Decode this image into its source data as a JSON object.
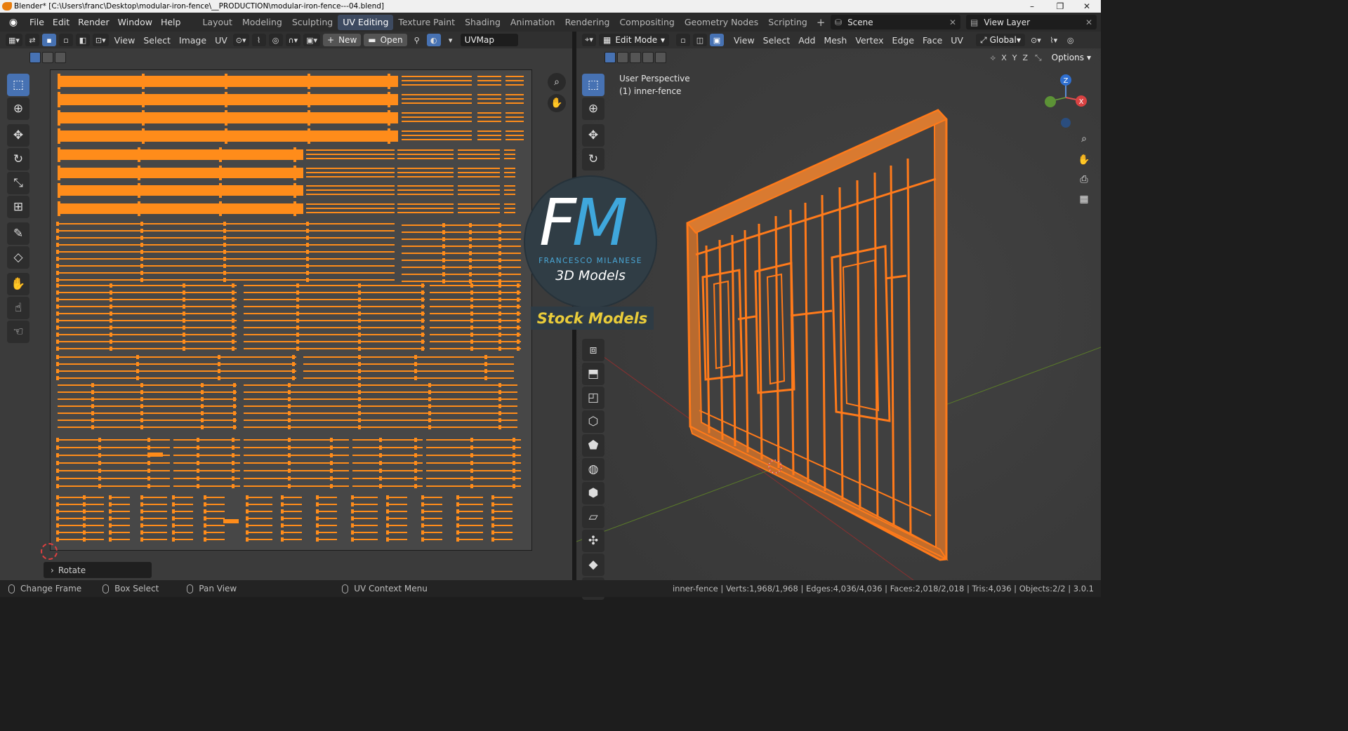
{
  "window": {
    "title": "Blender* [C:\\Users\\franc\\Desktop\\modular-iron-fence\\__PRODUCTION\\modular-iron-fence---04.blend]",
    "controls": {
      "minimize": "–",
      "maximize": "❐",
      "close": "✕"
    }
  },
  "topbar": {
    "menus": [
      "File",
      "Edit",
      "Render",
      "Window",
      "Help"
    ],
    "workspaces": [
      "Layout",
      "Modeling",
      "Sculpting",
      "UV Editing",
      "Texture Paint",
      "Shading",
      "Animation",
      "Rendering",
      "Compositing",
      "Geometry Nodes",
      "Scripting"
    ],
    "active_workspace": "UV Editing",
    "add_tab": "+",
    "scene": "Scene",
    "view_layer": "View Layer"
  },
  "uv_editor": {
    "menus": [
      "View",
      "Select",
      "Image",
      "UV"
    ],
    "new_label": "New",
    "open_label": "Open",
    "uvmap": "UVMap",
    "last_operator": "Rotate"
  },
  "viewport": {
    "mode": "Edit Mode",
    "menus": [
      "View",
      "Select",
      "Add",
      "Mesh",
      "Vertex",
      "Edge",
      "Face",
      "UV"
    ],
    "orientation": "Global",
    "options": "Options",
    "perspective": "User Perspective",
    "object": "(1) inner-fence",
    "axes": {
      "x": "X",
      "y": "Y",
      "z": "Z"
    }
  },
  "watermark": {
    "letters_f": "F",
    "letters_m": "M",
    "name": "FRANCESCO MILANESE",
    "subtitle": "3D Models",
    "badge": "Stock Models"
  },
  "statusbar": {
    "hints": [
      "Change Frame",
      "Box Select",
      "Pan View",
      "UV Context Menu"
    ],
    "stats": "inner-fence | Verts:1,968/1,968 | Edges:4,036/4,036 | Faces:2,018/2,018 | Tris:4,036 | Objects:2/2 | 3.0.1"
  },
  "colors": {
    "accent": "#4772b3",
    "uv_selected": "#ff8c1a",
    "wireframe": "#ff7a1a",
    "fm_f": "#ffffff",
    "fm_m": "#3fa7dc",
    "badge_text": "#e9cc3a"
  }
}
